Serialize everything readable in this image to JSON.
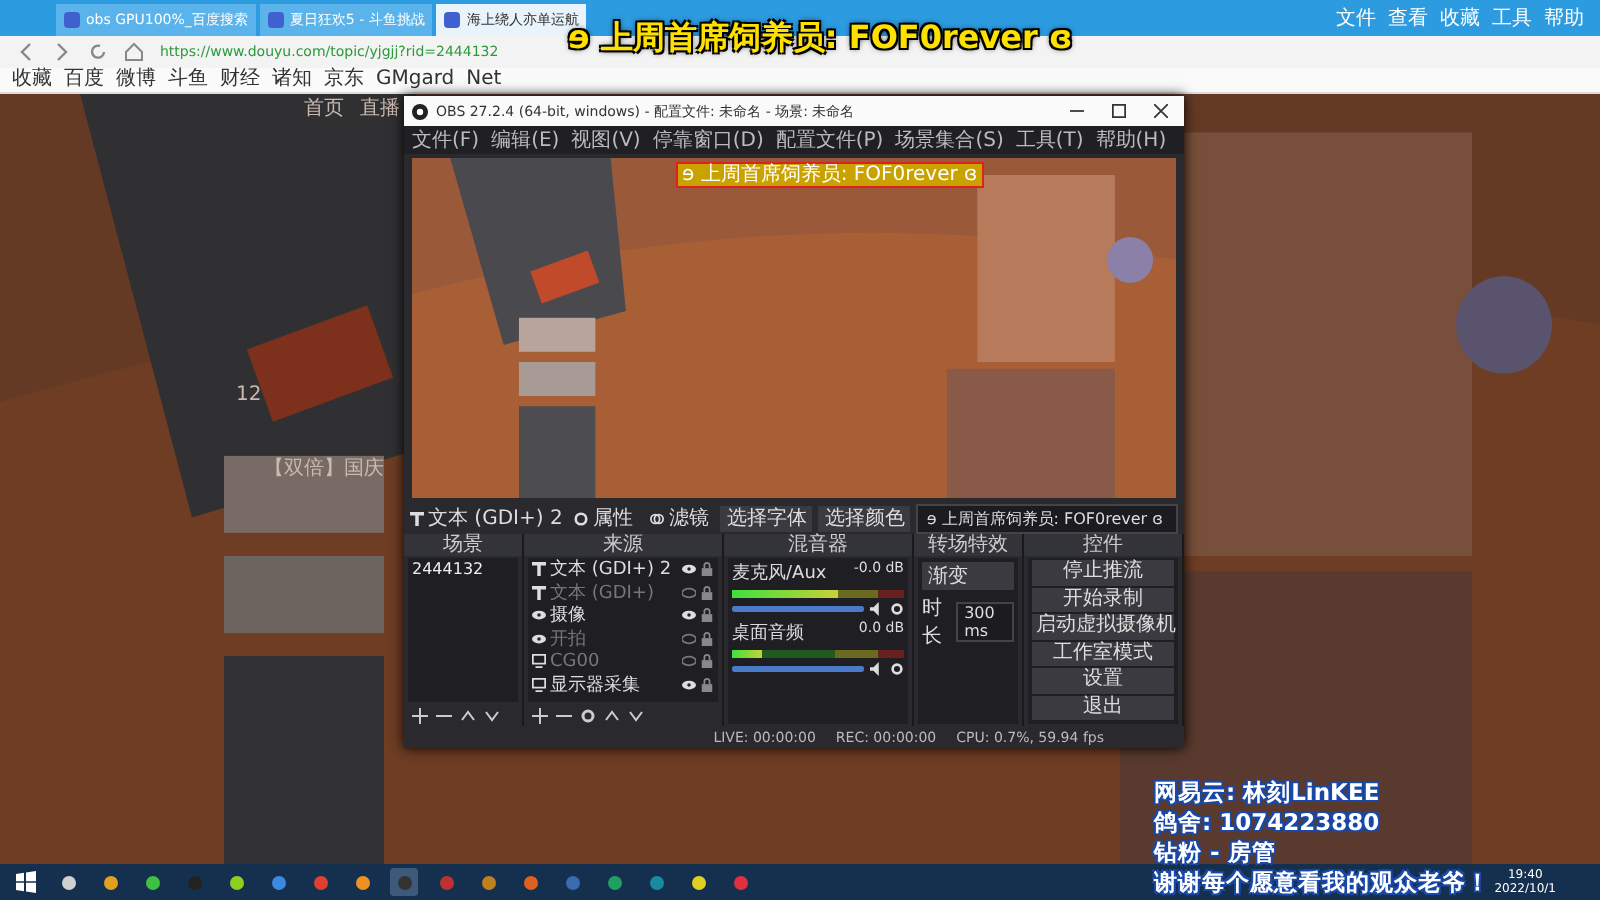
{
  "browser": {
    "tabs": [
      {
        "label": "obs GPU100%_百度搜索",
        "selected": false
      },
      {
        "label": "夏日狂欢5 - 斗鱼挑战",
        "selected": false
      },
      {
        "label": "海上绕人亦单运航",
        "selected": true
      }
    ],
    "menu": [
      "文件",
      "查看",
      "收藏",
      "工具",
      "帮助"
    ],
    "address": "https://www.douyu.com/topic/yjgjj?rid=2444132",
    "bookmarks": [
      "收藏",
      "百度",
      "微博",
      "斗鱼",
      "财经",
      "诸知",
      "京东",
      "GMgard",
      "Net"
    ]
  },
  "page": {
    "nav": [
      "首页",
      "直播"
    ],
    "stat": "12",
    "headline": "【双倍】国庆"
  },
  "obs": {
    "title": "OBS 27.2.4 (64-bit, windows) - 配置文件: 未命名 - 场景: 未命名",
    "menu": [
      "文件(F)",
      "编辑(E)",
      "视图(V)",
      "停靠窗口(D)",
      "配置文件(P)",
      "场景集合(S)",
      "工具(T)",
      "帮助(H)"
    ],
    "preview_text": "ɘ 上周首席饲养员: FOF0rever ɞ",
    "toolbar": {
      "source": "文本 (GDI+) 2",
      "properties": "属性",
      "filters": "滤镜",
      "font_button": "选择字体",
      "color_button": "选择颜色",
      "text": "ɘ 上周首席饲养员: FOF0rever ɞ"
    },
    "headers": [
      "场景",
      "来源",
      "混音器",
      "转场特效",
      "控件"
    ],
    "scenes": [
      {
        "name": "2444132",
        "selected": false
      }
    ],
    "sources": [
      {
        "name": "文本 (GDI+) 2",
        "kind": "text",
        "visible": true
      },
      {
        "name": "文本 (GDI+)",
        "kind": "text",
        "visible": false
      },
      {
        "name": "摄像",
        "kind": "camera",
        "visible": true
      },
      {
        "name": "开拍",
        "kind": "camera",
        "visible": false
      },
      {
        "name": "CG00",
        "kind": "display",
        "visible": false
      },
      {
        "name": "显示器采集",
        "kind": "display",
        "visible": true
      }
    ],
    "mixer": [
      {
        "name": "麦克风/Aux",
        "reading": "-0.0 dB",
        "meter": {
          "level": 0.62
        },
        "volume": {
          "level": 1
        }
      },
      {
        "name": "桌面音频",
        "reading": "0.0 dB",
        "meter": {
          "level": 0.18
        },
        "volume": {
          "level": 1
        }
      }
    ],
    "transition": {
      "type": "渐变",
      "duration_label": "时长",
      "duration": "300 ms"
    },
    "controls": [
      "停止推流",
      "开始录制",
      "启动虚拟摄像机",
      "工作室模式",
      "设置",
      "退出"
    ],
    "status": [
      "LIVE: 00:00:00",
      "REC: 00:00:00",
      "CPU: 0.7%, 59.94 fps"
    ]
  },
  "overlay": {
    "title": "ɘ 上周首席饲养员: FOF0rever ɞ",
    "lines": [
      "网易云: 林刻LinKEE",
      "鸽舍: 1074223880",
      "钻粉 - 房管",
      "谢谢每个愿意看我的观众老爷！"
    ]
  },
  "taskbar": {
    "apps": [
      {
        "selected": false
      },
      {
        "selected": false
      },
      {
        "selected": false
      },
      {
        "selected": false
      },
      {
        "selected": false
      },
      {
        "selected": false
      },
      {
        "selected": false
      },
      {
        "selected": false
      },
      {
        "selected": true
      },
      {
        "selected": false
      },
      {
        "selected": false
      },
      {
        "selected": false
      },
      {
        "selected": false
      },
      {
        "selected": false
      },
      {
        "selected": false
      },
      {
        "selected": false
      },
      {
        "selected": false
      }
    ],
    "time": "19:40",
    "date": "2022/10/1"
  }
}
